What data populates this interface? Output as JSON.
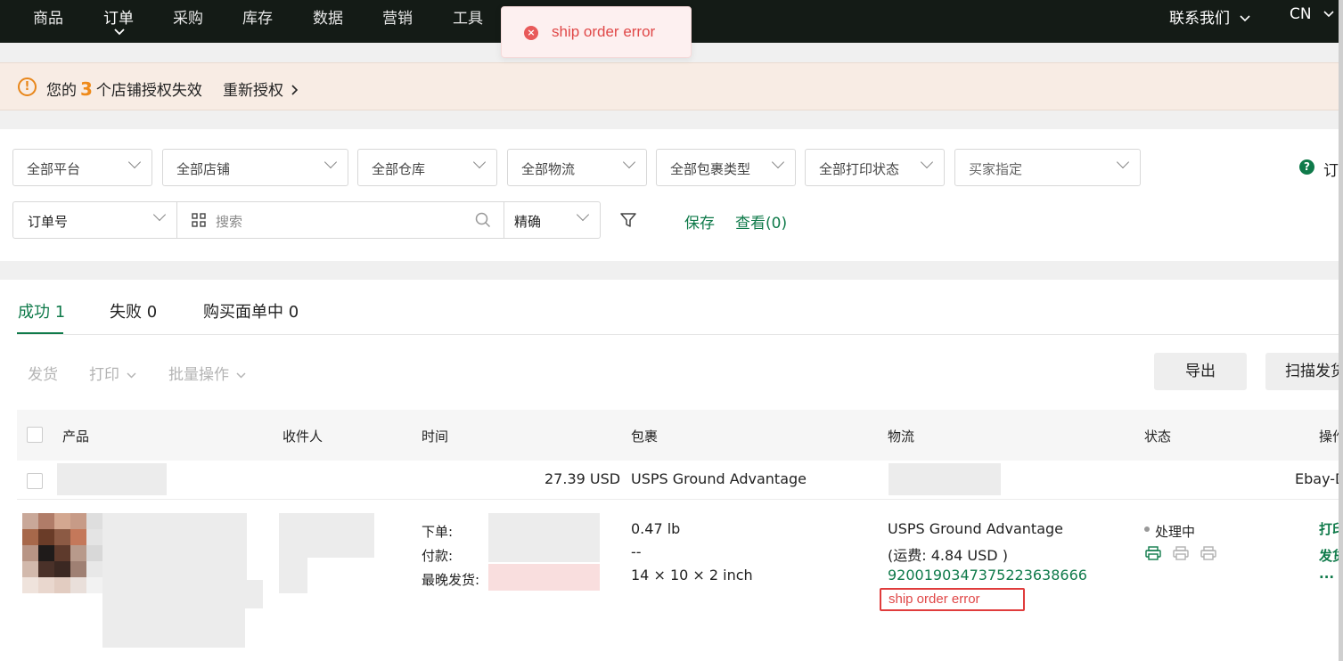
{
  "nav": {
    "items": [
      "商品",
      "订单",
      "采购",
      "库存",
      "数据",
      "营销",
      "工具"
    ],
    "active_index": 1,
    "contact": "联系我们",
    "lang": "CN"
  },
  "toast": {
    "message": "ship order error"
  },
  "warning": {
    "prefix": "您的",
    "count": "3",
    "suffix": "个店铺授权失效",
    "reauth": "重新授权"
  },
  "filters": {
    "platform": "全部平台",
    "store": "全部店铺",
    "warehouse": "全部仓库",
    "logistics": "全部物流",
    "package_type": "全部包裹类型",
    "print_status": "全部打印状态",
    "buyer_specified": "买家指定",
    "help_text": "订",
    "field": "订单号",
    "search_placeholder": "搜索",
    "match": "精确",
    "save": "保存",
    "view": "查看(0)"
  },
  "tabs": {
    "success": "成功 1",
    "failed": "失败 0",
    "buying_label": "购买面单中 0"
  },
  "actions": {
    "ship": "发货",
    "print": "打印",
    "batch": "批量操作",
    "export": "导出",
    "scan_ship": "扫描发货"
  },
  "table": {
    "headers": {
      "product": "产品",
      "recipient": "收件人",
      "time": "时间",
      "package": "包裹",
      "logistics": "物流",
      "status": "状态",
      "operation": "操作"
    },
    "summary_row": {
      "amount": "27.39 USD",
      "shipping_service": "USPS Ground Advantage",
      "platform": "Ebay-D"
    },
    "order": {
      "time_labels": [
        "下单:",
        "付款:",
        "最晚发货:"
      ],
      "weight": "0.47 lb",
      "weight2": "--",
      "dimensions": "14 × 10 × 2 inch",
      "carrier": "USPS Ground Advantage",
      "freight": "(运费:  4.84 USD )",
      "tracking": "9200190347375223638666",
      "error": "ship order error",
      "status": "处理中",
      "op_print": "打印",
      "op_ship": "发货",
      "op_more": "..."
    }
  },
  "colors": {
    "nav_bg": "#141b16",
    "accent_green": "#0f7a4a",
    "error_red": "#e04848",
    "warn_orange": "#ef8a1a"
  }
}
